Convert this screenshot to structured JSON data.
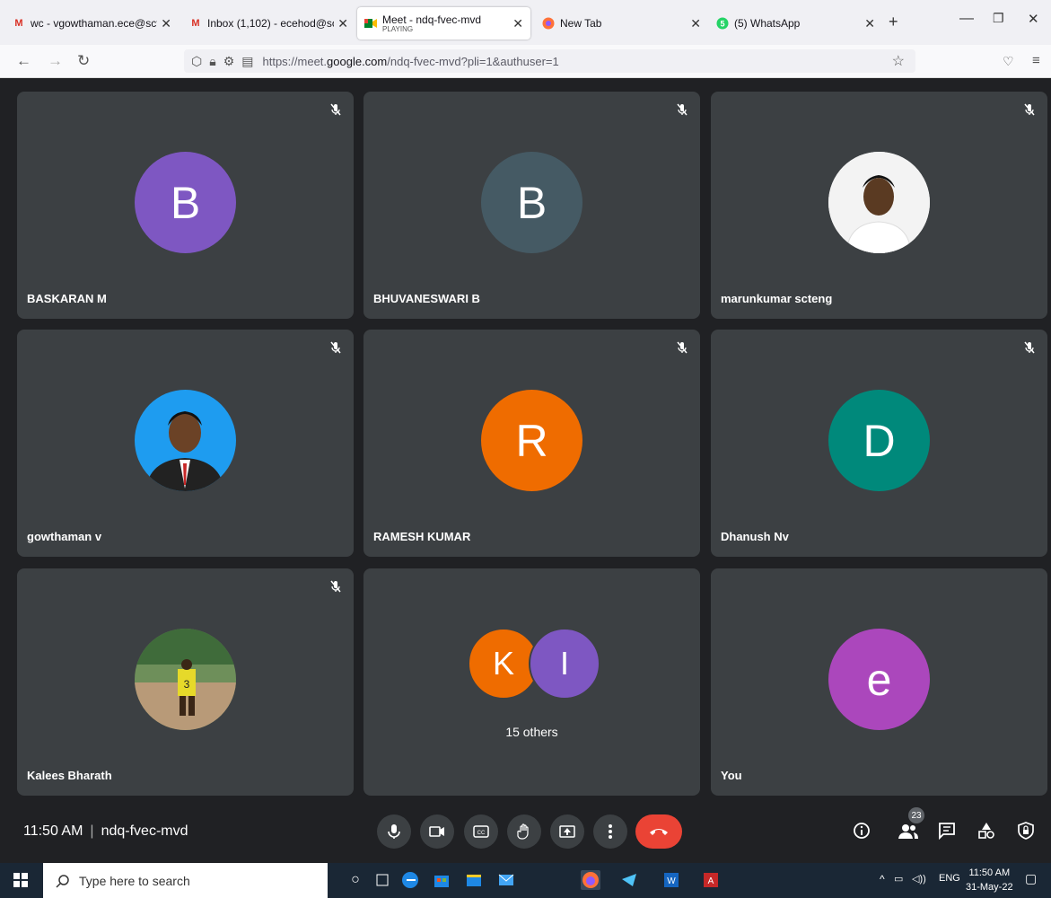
{
  "browser": {
    "tabs": [
      {
        "title": "wc - vgowthaman.ece@scten",
        "icon": "gmail-icon",
        "close": "✕"
      },
      {
        "title": "Inbox (1,102) - ecehod@scten",
        "icon": "gmail-icon",
        "close": "✕"
      },
      {
        "title": "Meet - ndq-fvec-mvd",
        "subtitle": "PLAYING",
        "icon": "meet-icon",
        "close": "✕"
      },
      {
        "title": "New Tab",
        "icon": "firefox-icon",
        "close": "✕"
      },
      {
        "title": "(5) WhatsApp",
        "icon": "whatsapp-icon",
        "close": "✕"
      }
    ],
    "new_tab": "+",
    "url_prefix": "https://meet.",
    "url_domain": "google.com",
    "url_path": "/ndq-fvec-mvd?pli=1&authuser=1"
  },
  "meet": {
    "tiles": [
      {
        "name": "BASKARAN M",
        "initial": "B",
        "color": "#7e57c2",
        "muted": true
      },
      {
        "name": "BHUVANESWARI B",
        "initial": "B",
        "color": "#455a64",
        "muted": true
      },
      {
        "name": "marunkumar scteng",
        "photo": "photo-avatar",
        "muted": true
      },
      {
        "name": "gowthaman v",
        "photo": "photo-avatar",
        "muted": true
      },
      {
        "name": "RAMESH KUMAR",
        "initial": "R",
        "color": "#ef6c00",
        "muted": true
      },
      {
        "name": "Dhanush Nv",
        "initial": "D",
        "color": "#00897b",
        "muted": true
      },
      {
        "name": "Kalees Bharath",
        "photo": "photo-avatar",
        "muted": true
      },
      {
        "name": "",
        "others": "15 others",
        "initials": [
          "K",
          "I"
        ]
      },
      {
        "name": "You",
        "initial": "e",
        "color": "#ab47bc",
        "muted": false
      }
    ],
    "time": "11:50 AM",
    "meeting_code": "ndq-fvec-mvd",
    "participants_count": "23"
  },
  "taskbar": {
    "search_placeholder": "Type here to search",
    "tray_lang": "ENG",
    "time": "11:50 AM",
    "date": "31-May-22"
  }
}
